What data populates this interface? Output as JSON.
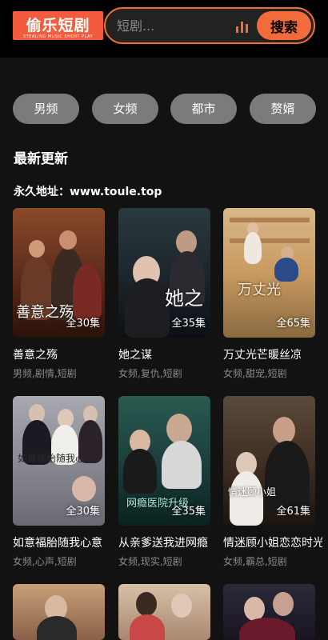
{
  "header": {
    "logo_text": "偷乐短剧",
    "logo_subtext": "STEALING MUSIC SHORT PLAY",
    "search_placeholder": "短剧...",
    "search_button": "搜索",
    "chart_icon": "bar-chart-icon"
  },
  "categories": [
    "男频",
    "女频",
    "都市",
    "赘婿"
  ],
  "section_title": "最新更新",
  "permalink": "永久地址：www.toule.top",
  "cards": [
    {
      "title": "善意之殇",
      "tags": "男频,剧情,短剧",
      "episodes": "全30集",
      "poster_text": "善意之殇"
    },
    {
      "title": "她之谋",
      "tags": "女频,复仇,短剧",
      "episodes": "全35集",
      "poster_text": "她之"
    },
    {
      "title": "万丈光芒暖丝凉",
      "tags": "女频,甜宠,短剧",
      "episodes": "全65集",
      "poster_text": "万丈光"
    },
    {
      "title": "如意福胎随我心意",
      "tags": "女频,心声,短剧",
      "episodes": "全30集",
      "poster_text": "如意福胎随我心"
    },
    {
      "title": "从亲爹送我进网瘾",
      "tags": "女频,现实,短剧",
      "episodes": "全35集",
      "poster_text": "网瘾医院升级"
    },
    {
      "title": "情迷顾小姐恋恋时光",
      "tags": "女频,霸总,短剧",
      "episodes": "全61集",
      "poster_text": "情迷顾小姐"
    }
  ]
}
